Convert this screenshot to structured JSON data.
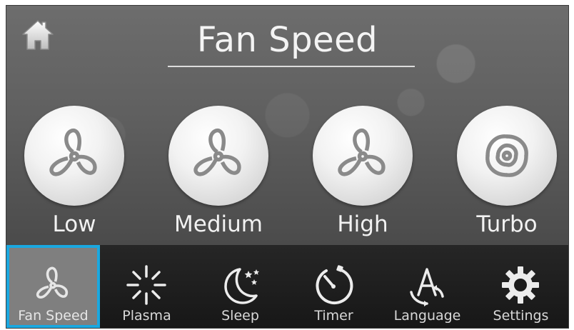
{
  "header": {
    "title": "Fan Speed",
    "home_icon": "home-icon"
  },
  "speeds": [
    {
      "label": "Low",
      "icon": "fan-icon"
    },
    {
      "label": "Medium",
      "icon": "fan-icon"
    },
    {
      "label": "High",
      "icon": "fan-icon"
    },
    {
      "label": "Turbo",
      "icon": "turbo-swirl-icon"
    }
  ],
  "tabs": [
    {
      "label": "Fan Speed",
      "icon": "fan-icon",
      "active": true
    },
    {
      "label": "Plasma",
      "icon": "plasma-burst-icon",
      "active": false
    },
    {
      "label": "Sleep",
      "icon": "moon-stars-icon",
      "active": false
    },
    {
      "label": "Timer",
      "icon": "stopwatch-icon",
      "active": false
    },
    {
      "label": "Language",
      "icon": "language-a-icon",
      "active": false
    },
    {
      "label": "Settings",
      "icon": "gear-icon",
      "active": false
    }
  ],
  "colors": {
    "active_tab_border": "#1aa8e0",
    "background": "#5f5f5f",
    "tab_bar": "#1c1c1c"
  }
}
